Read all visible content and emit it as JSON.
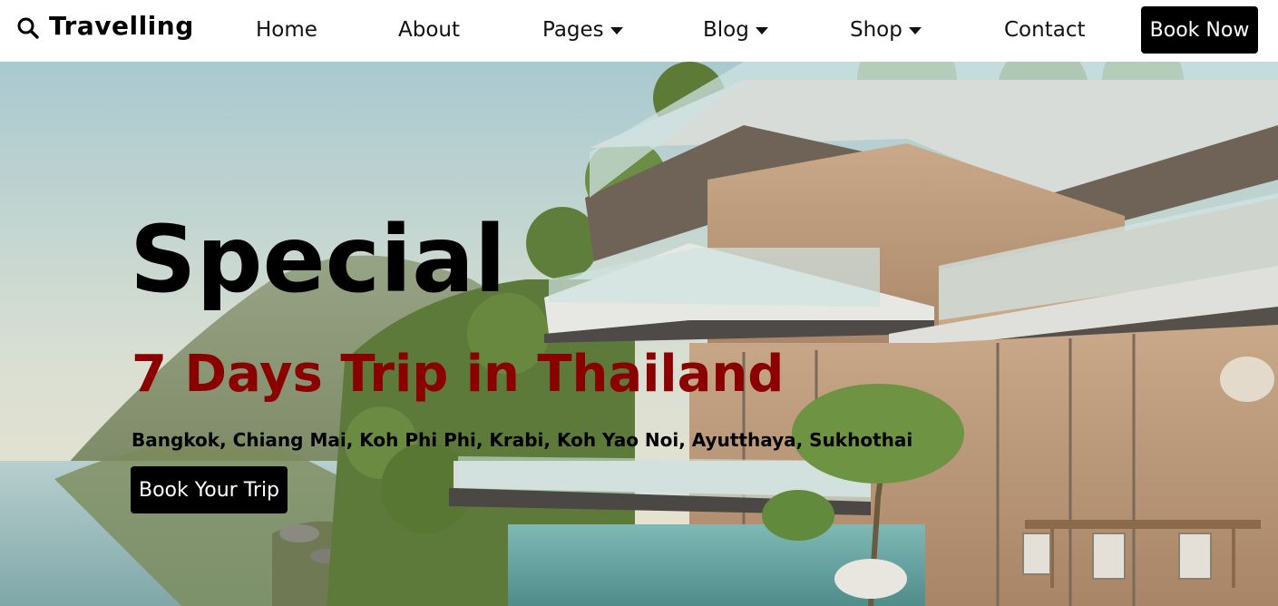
{
  "brand": {
    "name": "Travelling",
    "icon": "search-icon"
  },
  "nav": {
    "home": "Home",
    "about": "About",
    "pages": "Pages",
    "blog": "Blog",
    "shop": "Shop",
    "contact": "Contact",
    "book_now": "Book Now"
  },
  "hero": {
    "title": "Special",
    "subtitle": "7 Days Trip in Thailand",
    "places": "Bangkok, Chiang Mai, Koh Phi Phi, Krabi, Koh Yao Noi, Ayutthaya, Sukhothai",
    "cta": "Book Your Trip"
  },
  "colors": {
    "accent": "#8b0000",
    "button_bg": "#000000",
    "button_text": "#ffffff"
  }
}
